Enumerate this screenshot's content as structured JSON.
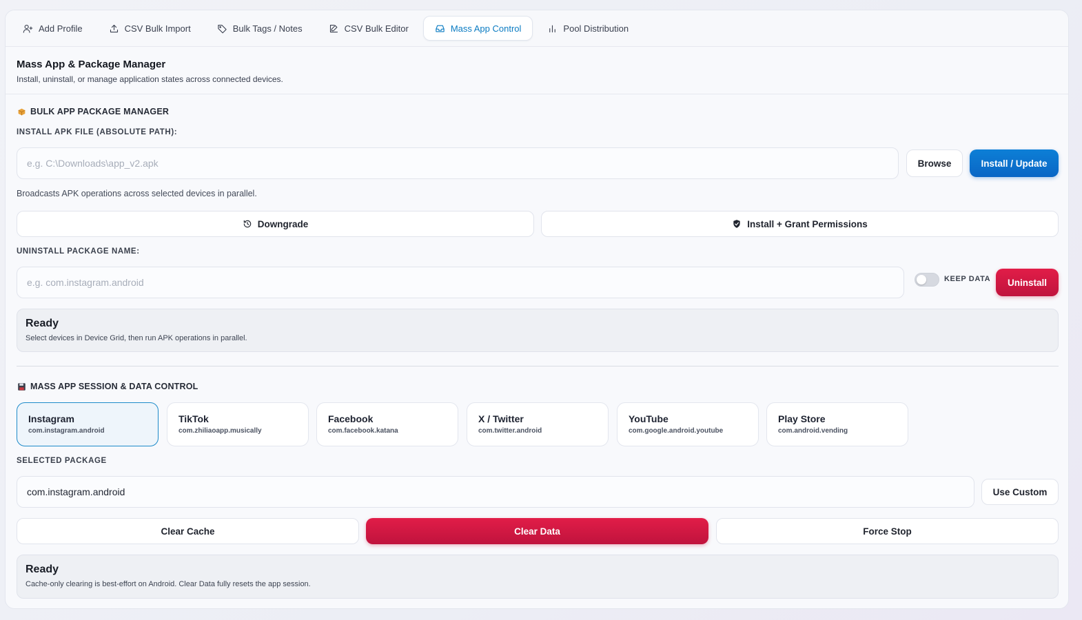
{
  "tabs": [
    {
      "label": "Add Profile",
      "icon": "user-plus-icon"
    },
    {
      "label": "CSV Bulk Import",
      "icon": "upload-icon"
    },
    {
      "label": "Bulk Tags / Notes",
      "icon": "tag-icon"
    },
    {
      "label": "CSV Bulk Editor",
      "icon": "edit-icon"
    },
    {
      "label": "Mass App Control",
      "icon": "inbox-icon",
      "active": true
    },
    {
      "label": "Pool Distribution",
      "icon": "bar-chart-icon"
    }
  ],
  "header": {
    "title": "Mass App & Package Manager",
    "subtitle": "Install, uninstall, or manage application states across connected devices."
  },
  "package_manager": {
    "section_title": "BULK APP PACKAGE MANAGER",
    "section_icon": "package-icon",
    "install_label": "INSTALL APK FILE (ABSOLUTE PATH):",
    "install_placeholder": "e.g. C:\\Downloads\\app_v2.apk",
    "browse_label": "Browse",
    "install_button": "Install / Update",
    "hint": "Broadcasts APK operations across selected devices in parallel.",
    "downgrade_label": "Downgrade",
    "grant_label": "Install + Grant Permissions",
    "uninstall_label": "UNINSTALL PACKAGE NAME:",
    "uninstall_placeholder": "e.g. com.instagram.android",
    "keep_data_label": "KEEP DATA",
    "keep_data_on": false,
    "uninstall_button": "Uninstall",
    "status_title": "Ready",
    "status_text": "Select devices in Device Grid, then run APK operations in parallel."
  },
  "session_control": {
    "section_title": "MASS APP SESSION & DATA CONTROL",
    "section_icon": "floppy-disk-icon",
    "apps": [
      {
        "name": "Instagram",
        "pkg": "com.instagram.android",
        "selected": true
      },
      {
        "name": "TikTok",
        "pkg": "com.zhiliaoapp.musically"
      },
      {
        "name": "Facebook",
        "pkg": "com.facebook.katana"
      },
      {
        "name": "X / Twitter",
        "pkg": "com.twitter.android"
      },
      {
        "name": "YouTube",
        "pkg": "com.google.android.youtube"
      },
      {
        "name": "Play Store",
        "pkg": "com.android.vending"
      }
    ],
    "selected_label": "SELECTED PACKAGE",
    "selected_value": "com.instagram.android",
    "use_custom_label": "Use Custom",
    "clear_cache_label": "Clear Cache",
    "clear_data_label": "Clear Data",
    "force_stop_label": "Force Stop",
    "status_title": "Ready",
    "status_text": "Cache-only clearing is best-effort on Android. Clear Data fully resets the app session."
  },
  "colors": {
    "accent": "#0a7bc2",
    "primary_button": "#0a66c5",
    "danger_button": "#e11d48"
  }
}
